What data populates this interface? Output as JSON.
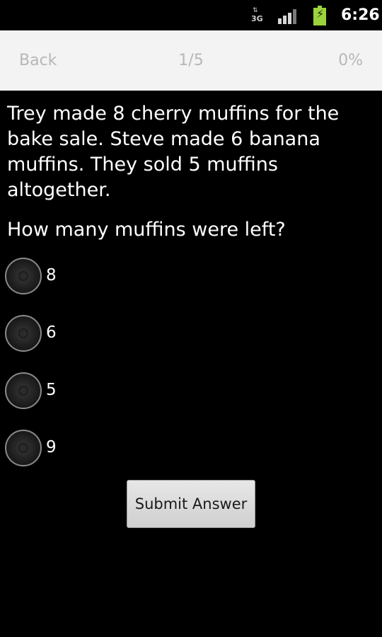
{
  "status_bar": {
    "network_type": "3G",
    "network_icon": "data-arrows-icon",
    "signal_icon": "signal-strength-icon",
    "battery_icon": "battery-charging-icon",
    "time": "6:26"
  },
  "nav": {
    "back_label": "Back",
    "progress": "1/5",
    "percent": "0%"
  },
  "question": {
    "text": "Trey made 8 cherry muffins for the bake sale. Steve made 6 banana muffins. They sold 5 muffins altogether.",
    "prompt": "How many muffins were left?"
  },
  "options": [
    {
      "label": "8"
    },
    {
      "label": "6"
    },
    {
      "label": "5"
    },
    {
      "label": "9"
    }
  ],
  "submit_label": "Submit Answer"
}
